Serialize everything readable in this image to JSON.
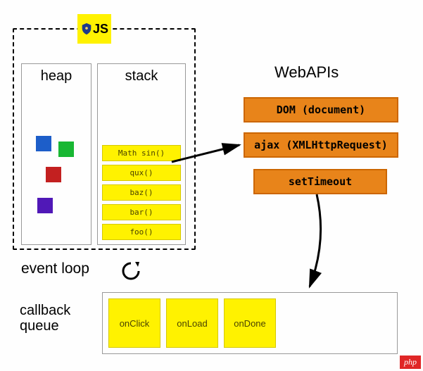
{
  "badge": {
    "label": "JS"
  },
  "heap": {
    "title": "heap"
  },
  "stack": {
    "title": "stack",
    "items": [
      "Math sin()",
      "qux()",
      "baz()",
      "bar()",
      "foo()"
    ]
  },
  "webapis": {
    "title": "WebAPIs",
    "items": [
      "DOM (document)",
      "ajax (XMLHttpRequest)",
      "setTimeout"
    ]
  },
  "eventLoop": {
    "label": "event loop"
  },
  "callbackQueue": {
    "label": "callback\nqueue",
    "items": [
      "onClick",
      "onLoad",
      "onDone"
    ]
  },
  "watermark": "php"
}
